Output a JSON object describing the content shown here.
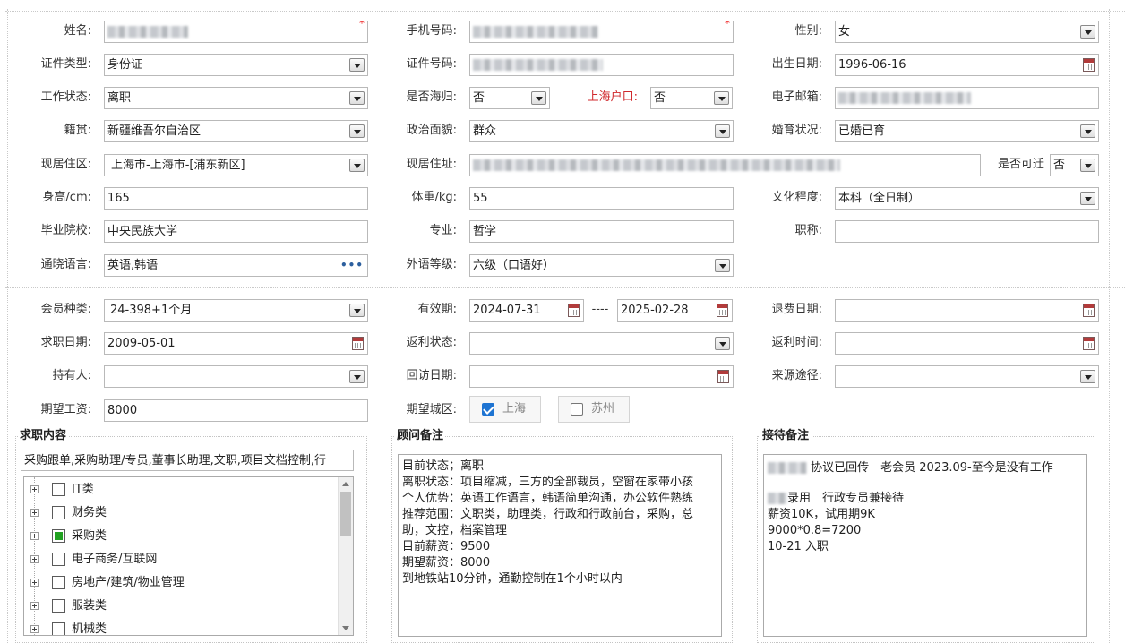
{
  "personal": {
    "name": {
      "label": "姓名:",
      "required": "*"
    },
    "phone": {
      "label": "手机号码:",
      "required": "*"
    },
    "gender": {
      "label": "性别:",
      "value": "女"
    },
    "id_type": {
      "label": "证件类型:",
      "value": "身份证"
    },
    "id_number": {
      "label": "证件号码:"
    },
    "birth_date": {
      "label": "出生日期:",
      "value": "1996-06-16"
    },
    "work_status": {
      "label": "工作状态:",
      "value": "离职"
    },
    "overseas_returnee": {
      "label": "是否海归:",
      "value": "否"
    },
    "shanghai_hukou": {
      "label": "上海户口:",
      "value": "否"
    },
    "email": {
      "label": "电子邮箱:"
    },
    "native_place": {
      "label": "籍贯:",
      "value": "新疆维吾尔自治区"
    },
    "political_status": {
      "label": "政治面貌:",
      "value": "群众"
    },
    "marital_status": {
      "label": "婚育状况:",
      "value": "已婚已育"
    },
    "residence_area": {
      "label": "现居住区:",
      "value": "上海市-上海市-[浦东新区]"
    },
    "residence_address": {
      "label": "现居住址:"
    },
    "can_relocate": {
      "label": "是否可迁",
      "value": "否"
    },
    "height": {
      "label": "身高/cm:",
      "value": "165"
    },
    "weight": {
      "label": "体重/kg:",
      "value": "55"
    },
    "education": {
      "label": "文化程度:",
      "value": "本科（全日制）"
    },
    "school": {
      "label": "毕业院校:",
      "value": "中央民族大学"
    },
    "major": {
      "label": "专业:",
      "value": "哲学"
    },
    "title": {
      "label": "职称:",
      "value": ""
    },
    "languages": {
      "label": "通晓语言:",
      "value": "英语,韩语",
      "more": "•••"
    },
    "foreign_level": {
      "label": "外语等级:",
      "value": "六级（口语好）"
    }
  },
  "membership": {
    "member_type": {
      "label": "会员种类:",
      "value": "24-398+1个月"
    },
    "validity": {
      "label": "有效期:",
      "from": "2024-07-31",
      "sep": "----",
      "to": "2025-02-28"
    },
    "refund_date": {
      "label": "退费日期:",
      "value": ""
    },
    "job_seek_date": {
      "label": "求职日期:",
      "value": "2009-05-01"
    },
    "rebate_status": {
      "label": "返利状态:",
      "value": ""
    },
    "rebate_time": {
      "label": "返利时间:",
      "value": ""
    },
    "holder": {
      "label": "持有人:",
      "value": ""
    },
    "revisit_date": {
      "label": "回访日期:",
      "value": ""
    },
    "source": {
      "label": "来源途径:",
      "value": ""
    },
    "expected_salary": {
      "label": "期望工资:",
      "value": "8000"
    },
    "expected_city": {
      "label": "期望城区:",
      "options": [
        {
          "label": "上海",
          "checked": true
        },
        {
          "label": "苏州",
          "checked": false
        }
      ]
    }
  },
  "job_content": {
    "title": "求职内容",
    "summary": "采购跟单,采购助理/专员,董事长助理,文职,项目文档控制,行",
    "tree": [
      {
        "label": "IT类",
        "state": "none"
      },
      {
        "label": "财务类",
        "state": "none"
      },
      {
        "label": "采购类",
        "state": "partial"
      },
      {
        "label": "电子商务/互联网",
        "state": "none"
      },
      {
        "label": "房地产/建筑/物业管理",
        "state": "none"
      },
      {
        "label": "服装类",
        "state": "none"
      },
      {
        "label": "机械类",
        "state": "none"
      }
    ]
  },
  "consultant_notes": {
    "title": "顾问备注",
    "lines": [
      "目前状态；离职",
      "离职状态：项目缩减，三方的全部裁员，空窗在家带小孩",
      "个人优势：英语工作语言，韩语简单沟通，办公软件熟练",
      "推荐范围：文职类，助理类，行政和行政前台，采购，总",
      "助，文控，档案管理",
      "目前薪资：9500",
      "期望薪资：8000",
      "到地铁站10分钟，通勤控制在1个小时以内"
    ]
  },
  "reception_notes": {
    "title": "接待备注",
    "line1_rest": "协议已回传　老会员 2023.09-至今是没有工作",
    "line2_rest": "录用　行政专员兼接待",
    "lines": [
      "薪资10K，试用期9K",
      "9000*0.8=7200",
      "10-21 入职"
    ]
  }
}
